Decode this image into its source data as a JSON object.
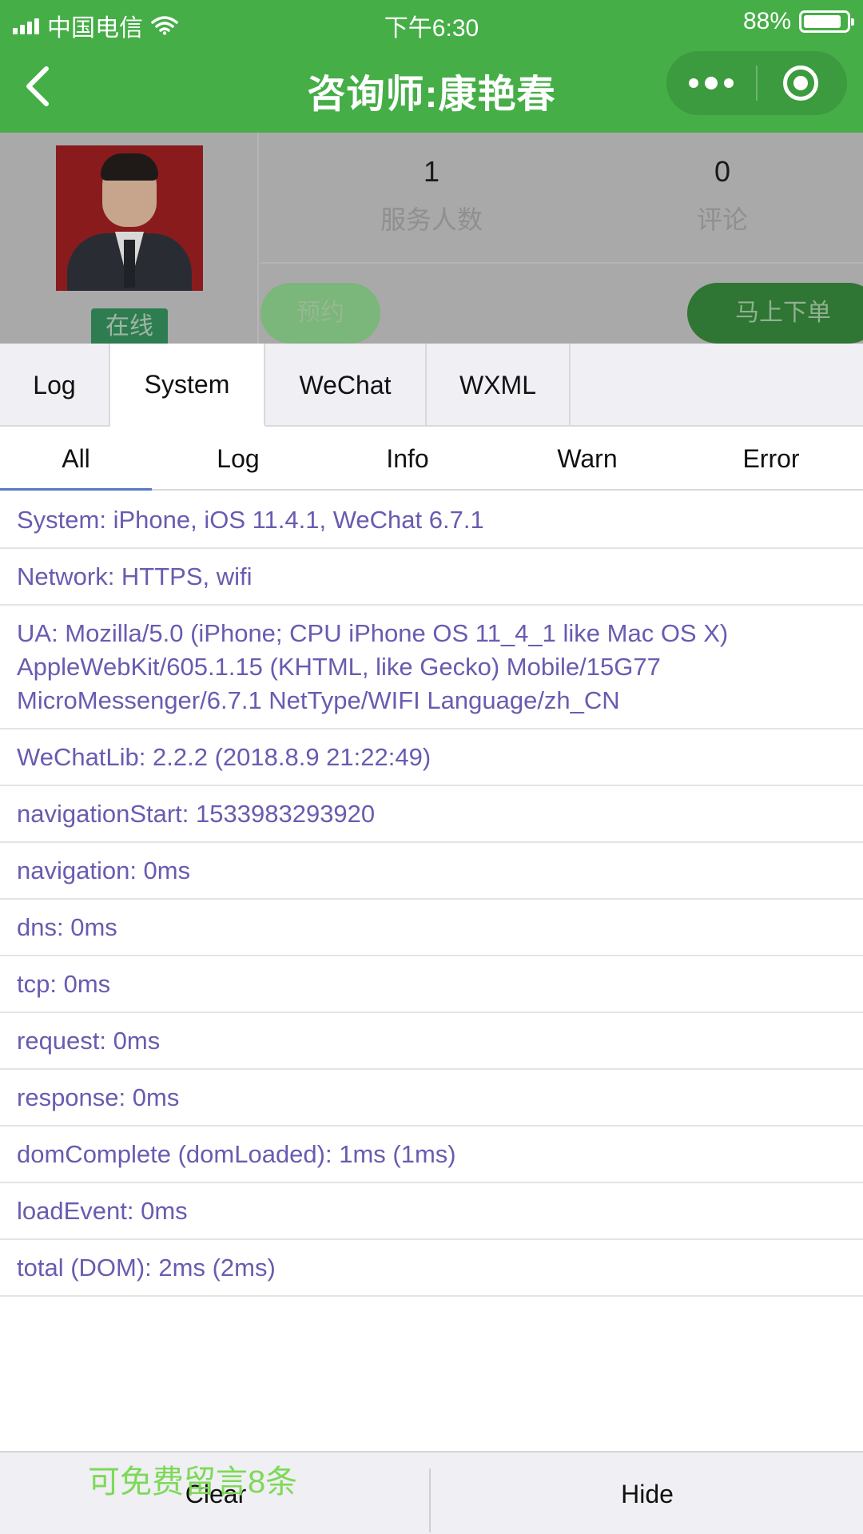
{
  "status_bar": {
    "carrier": "中国电信",
    "time": "下午6:30",
    "battery_percent": "88%",
    "battery_level": 0.88
  },
  "nav": {
    "title": "咨询师:康艳春",
    "back_icon": "chevron-left-icon",
    "more_icon": "more-dots-icon",
    "close_icon": "target-circle-icon"
  },
  "profile": {
    "status_badge": "在线",
    "stats": [
      {
        "value": "1",
        "label": "服务人数"
      },
      {
        "value": "0",
        "label": "评论"
      }
    ],
    "reserve_button": "预约",
    "order_button": "马上下单"
  },
  "console": {
    "tabs": [
      {
        "label": "Log",
        "active": false
      },
      {
        "label": "System",
        "active": true
      },
      {
        "label": "WeChat",
        "active": false
      },
      {
        "label": "WXML",
        "active": false
      }
    ],
    "filters": [
      {
        "label": "All",
        "active": true
      },
      {
        "label": "Log",
        "active": false
      },
      {
        "label": "Info",
        "active": false
      },
      {
        "label": "Warn",
        "active": false
      },
      {
        "label": "Error",
        "active": false
      }
    ],
    "rows": [
      "System: iPhone, iOS 11.4.1, WeChat 6.7.1",
      "Network: HTTPS, wifi",
      "UA: Mozilla/5.0 (iPhone; CPU iPhone OS 11_4_1 like Mac OS X) AppleWebKit/605.1.15 (KHTML, like Gecko) Mobile/15G77 MicroMessenger/6.7.1 NetType/WIFI Language/zh_CN",
      "WeChatLib: 2.2.2 (2018.8.9 21:22:49)",
      "navigationStart: 1533983293920",
      "navigation: 0ms",
      "dns: 0ms",
      "tcp: 0ms",
      "request: 0ms",
      "response: 0ms",
      "domComplete (domLoaded): 1ms (1ms)",
      "loadEvent: 0ms",
      "total (DOM): 2ms (2ms)"
    ],
    "clear_button": "Clear",
    "hide_button": "Hide"
  },
  "promo_text": "可免费留言8条",
  "colors": {
    "brand_green": "#45ae47",
    "log_text": "#6a5bb0",
    "promo_green": "#7ed957"
  }
}
